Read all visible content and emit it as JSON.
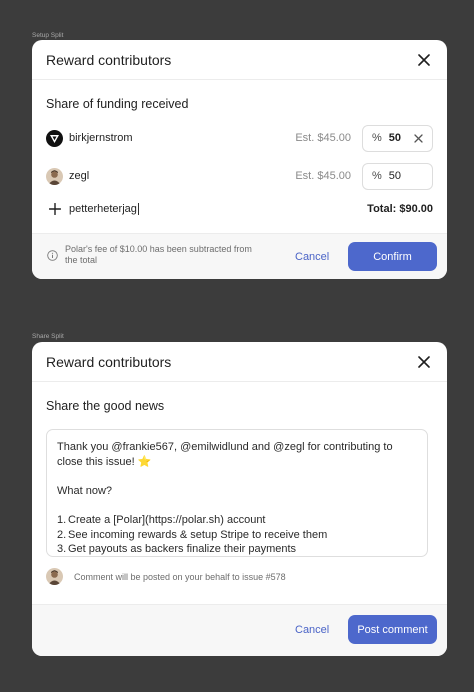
{
  "setup_split": {
    "frame_label": "Setup Split",
    "title": "Reward contributors",
    "section_title": "Share of funding received",
    "contributors": [
      {
        "username": "birkjernstrom",
        "estimate": "Est. $45.00",
        "percent_sign": "%",
        "percent": "50",
        "removable": true,
        "icon": "polar-logo-icon"
      },
      {
        "username": "zegl",
        "estimate": "Est. $45.00",
        "percent_sign": "%",
        "percent": "50",
        "removable": false,
        "icon": "user-avatar"
      }
    ],
    "add_user": {
      "icon": "plus-icon",
      "value": "petterheterjag"
    },
    "total": "Total: $90.00",
    "fee_note": "Polar's fee of $10.00 has been subtracted from the total",
    "cancel_label": "Cancel",
    "confirm_label": "Confirm"
  },
  "share_split": {
    "frame_label": "Share Split",
    "title": "Reward contributors",
    "section_title": "Share the good news",
    "message": {
      "line1": "Thank you @frankie567, @emilwidlund and @zegl for contributing to close this issue! ⭐",
      "line2": "What now?",
      "steps": [
        {
          "num": "1.",
          "text": "Create a [Polar](https://polar.sh) account"
        },
        {
          "num": "2.",
          "text": "See incoming rewards & setup Stripe to receive them"
        },
        {
          "num": "3.",
          "text": "Get payouts as backers finalize their payments"
        }
      ]
    },
    "comment_note": "Comment will be posted on your behalf to issue #578",
    "cancel_label": "Cancel",
    "post_label": "Post comment"
  },
  "colors": {
    "accent": "#4d68cc",
    "link": "#4b64c7",
    "background": "#3c3c3c"
  }
}
